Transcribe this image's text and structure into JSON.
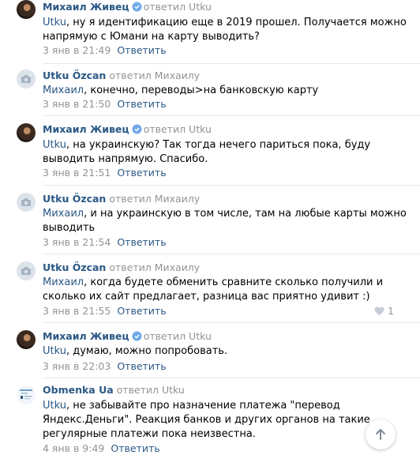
{
  "comments": [
    {
      "author": "Михаил Живец",
      "verified": true,
      "replied": "ответил Utku",
      "mention": "Utku",
      "text": ", ну я идентификацию еще в 2019 прошел. Получается можно напрямую с Юмани на карту выводить?",
      "date": "3 янв в 21:49",
      "reply_label": "Ответить"
    },
    {
      "author": "Utku Özcan",
      "verified": false,
      "replied": "ответил Михаилу",
      "mention": "Михаил",
      "text": ", конечно, переводы>на банковскую карту",
      "date": "3 янв в 21:50",
      "reply_label": "Ответить"
    },
    {
      "author": "Михаил Живец",
      "verified": true,
      "replied": "ответил Utku",
      "mention": "Utku",
      "text": ", на украинскую? Так тогда нечего париться пока, буду выводить напрямую. Спасибо.",
      "date": "3 янв в 21:51",
      "reply_label": "Ответить"
    },
    {
      "author": "Utku Özcan",
      "verified": false,
      "replied": "ответил Михаилу",
      "mention": "Михаил",
      "text": ", и на украинскую в том числе, там на любые карты можно выводить",
      "date": "3 янв в 21:54",
      "reply_label": "Ответить"
    },
    {
      "author": "Utku Özcan",
      "verified": false,
      "replied": "ответил Михаилу",
      "mention": "Михаил",
      "text": ", когда будете обменить сравните сколько получили и сколько их сайт предлагает, разница вас приятно удивит :)",
      "date": "3 янв в 21:55",
      "reply_label": "Ответить",
      "likes": "1"
    },
    {
      "author": "Михаил Живец",
      "verified": true,
      "replied": "ответил Utku",
      "mention": "Utku",
      "text": ", думаю, можно попробовать.",
      "date": "3 янв в 22:03",
      "reply_label": "Ответить"
    },
    {
      "author": "Obmenka Ua",
      "verified": false,
      "replied": "ответил Utku",
      "mention": "Utku",
      "text": ", не забывайте про назначение платежа \"перевод Яндекс.Деньги\". Реакция банков и других органов на такие регулярные платежи пока неизвестна.",
      "date": "4 янв в 9:49",
      "reply_label": "Ответить"
    }
  ],
  "colors": {
    "link": "#2a5885",
    "muted": "#939393",
    "verified": "#71aaeb"
  }
}
